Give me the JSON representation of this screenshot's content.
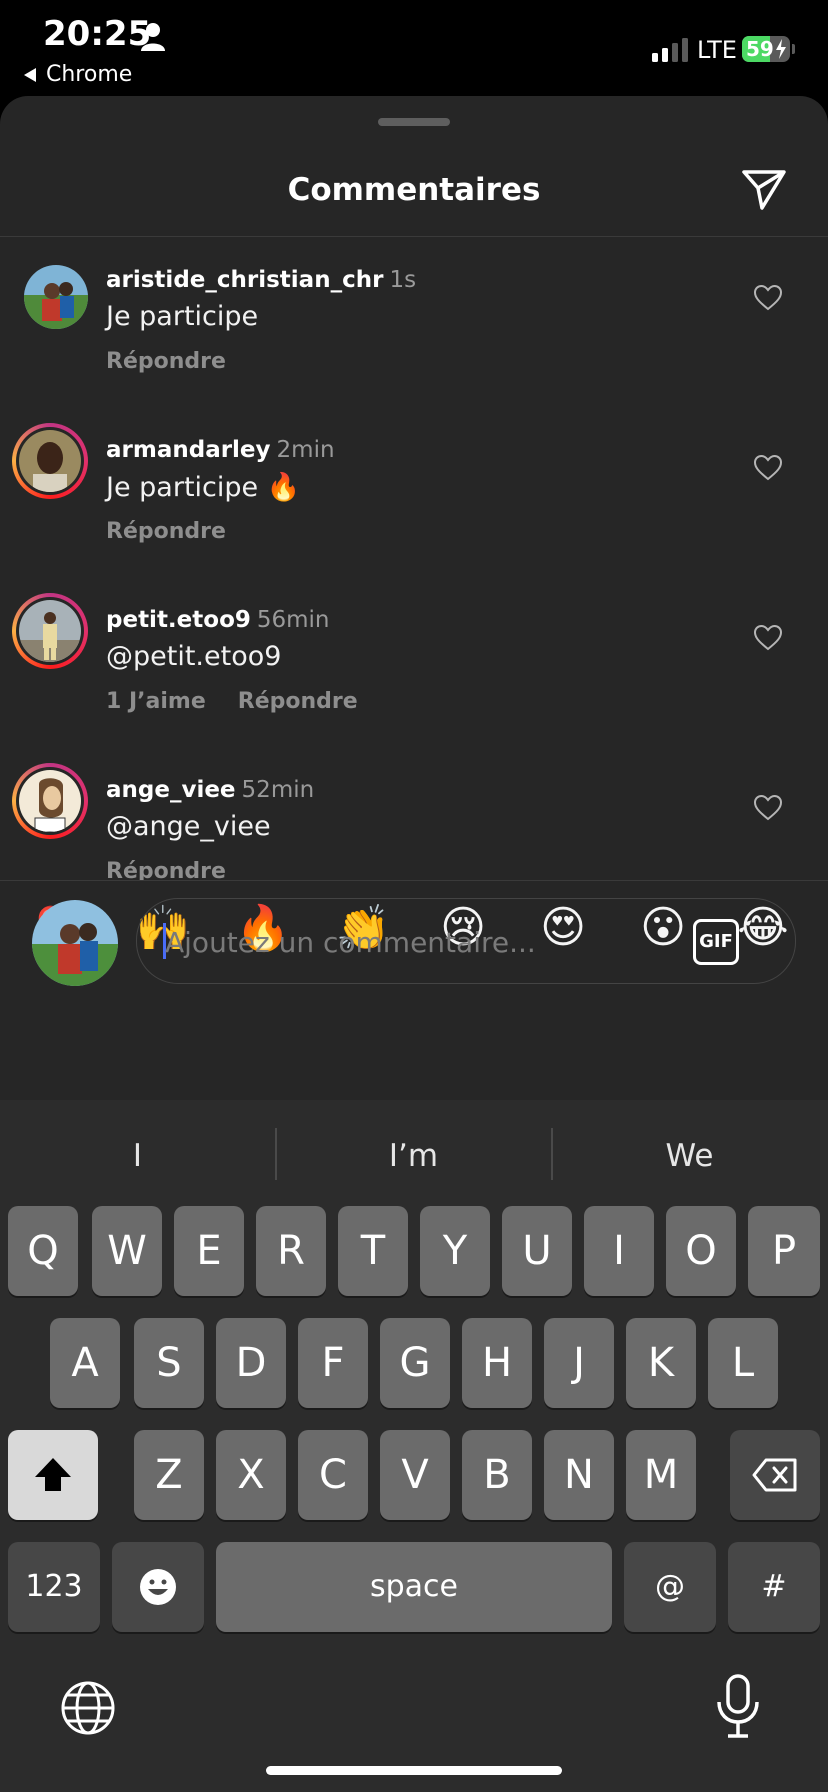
{
  "status_bar": {
    "time": "20:25",
    "back_app": "Chrome",
    "network": "LTE",
    "battery_level": "59",
    "battery_fraction": 0.59
  },
  "sheet": {
    "title": "Commentaires"
  },
  "comments": [
    {
      "username": "aristide_christian_chr",
      "time": "1s",
      "text": "Je participe",
      "likes": "",
      "reply": "Répondre"
    },
    {
      "username": "armandarley",
      "time": "2min",
      "text": "Je participe 🔥",
      "likes": "",
      "reply": "Répondre"
    },
    {
      "username": "petit.etoo9",
      "time": "56min",
      "text": "@petit.etoo9",
      "likes": "1 J’aime",
      "reply": "Répondre"
    },
    {
      "username": "ange_viee",
      "time": "52min",
      "text": "@ange_viee",
      "likes": "",
      "reply": "Répondre"
    }
  ],
  "quick_emojis": [
    "❤️",
    "🙌",
    "🔥",
    "👏",
    "😢",
    "😍",
    "😮",
    "😂"
  ],
  "composer": {
    "placeholder": "Ajoutez un commentaire...",
    "gif_label": "GIF"
  },
  "keyboard": {
    "suggestions": [
      "I",
      "I’m",
      "We"
    ],
    "row1": [
      "Q",
      "W",
      "E",
      "R",
      "T",
      "Y",
      "U",
      "I",
      "O",
      "P"
    ],
    "row2": [
      "A",
      "S",
      "D",
      "F",
      "G",
      "H",
      "J",
      "K",
      "L"
    ],
    "row3": [
      "Z",
      "X",
      "C",
      "V",
      "B",
      "N",
      "M"
    ],
    "numbers_label": "123",
    "space_label": "space",
    "at_label": "@",
    "hash_label": "#"
  },
  "icons": {
    "shift": "shift-icon",
    "backspace": "backspace-icon",
    "emoji": "emoji-icon",
    "globe": "globe-icon",
    "mic": "microphone-icon",
    "send": "send-icon",
    "heart": "heart-icon"
  }
}
